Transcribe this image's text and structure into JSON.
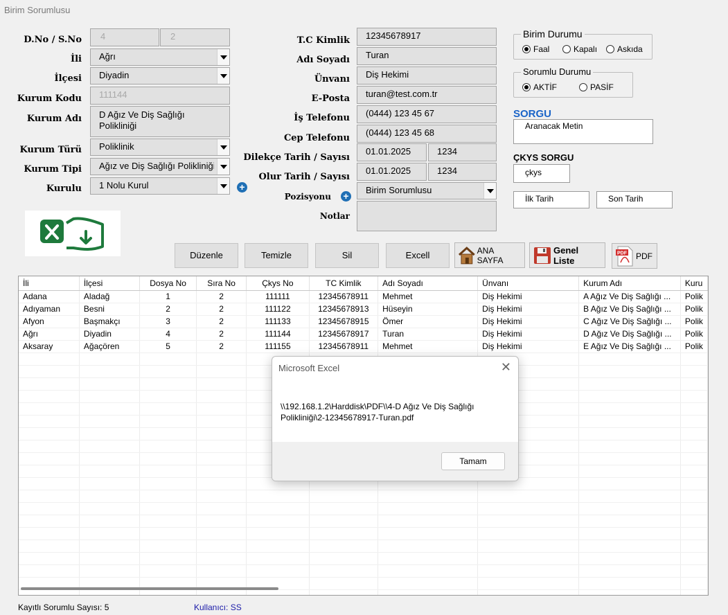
{
  "window": {
    "title": "Birim Sorumlusu"
  },
  "left": {
    "dno_label": "D.No / S.No",
    "dno_value": "4",
    "sno_value": "2",
    "ili_label": "İli",
    "ili_value": "Ağrı",
    "ilcesi_label": "İlçesi",
    "ilcesi_value": "Diyadin",
    "kurum_kodu_label": "Kurum Kodu",
    "kurum_kodu_value": "111144",
    "kurum_adi_label": "Kurum Adı",
    "kurum_adi_value": "D Ağız Ve Diş Sağlığı Polikliniği",
    "kurum_turu_label": "Kurum Türü",
    "kurum_turu_value": "Poliklinik",
    "kurum_tipi_label": "Kurum Tipi",
    "kurum_tipi_value": "Ağız ve Diş Sağlığı Polikliniği",
    "kurulu_label": "Kurulu",
    "kurulu_value": "1 Nolu Kurul"
  },
  "middle": {
    "tc_label": "T.C Kimlik",
    "tc_value": "12345678917",
    "adsoyad_label": "Adı Soyadı",
    "adsoyad_value": "Turan",
    "unvani_label": "Ünvanı",
    "unvani_value": "Diş Hekimi",
    "eposta_label": "E-Posta",
    "eposta_value": "turan@test.com.tr",
    "is_tel_label": "İş Telefonu",
    "is_tel_value": "(0444) 123 45 67",
    "cep_tel_label": "Cep Telefonu",
    "cep_tel_value": "(0444) 123 45 68",
    "dilekce_label": "Dilekçe Tarih / Sayısı",
    "dilekce_tarih": "01.01.2025",
    "dilekce_sayi": "1234",
    "olur_label": "Olur Tarih / Sayısı",
    "olur_tarih": "01.01.2025",
    "olur_sayi": "1234",
    "pozisyonu_label": "Pozisyonu",
    "pozisyonu_value": "Birim Sorumlusu",
    "notlar_label": "Notlar",
    "notlar_value": ""
  },
  "right": {
    "birim_durumu_title": "Birim Durumu",
    "birim_faal": "Faal",
    "birim_kapali": "Kapalı",
    "birim_askida": "Askıda",
    "sorumlu_durumu_title": "Sorumlu Durumu",
    "sorumlu_aktif": "AKTİF",
    "sorumlu_pasif": "PASİF",
    "sorgu_title": "SORGU",
    "sorgu_placeholder": "Aranacak Metin",
    "ckys_title": "ÇKYS SORGU",
    "ckys_placeholder": "çkys",
    "ilk_tarih": "İlk Tarih",
    "son_tarih": "Son Tarih"
  },
  "toolbar": {
    "duzenle": "Düzenle",
    "temizle": "Temizle",
    "sil": "Sil",
    "excell": "Excell",
    "ana_sayfa": "ANA SAYFA",
    "genel_liste": "Genel Liste",
    "pdf": "PDF"
  },
  "grid": {
    "columns": [
      "İli",
      "İlçesi",
      "Dosya No",
      "Sıra No",
      "Çkys No",
      "TC Kimlik",
      "Adı Soyadı",
      "Ünvanı",
      "Kurum Adı",
      "Kuru"
    ],
    "rows": [
      [
        "Adana",
        "Aladağ",
        "1",
        "2",
        "111111",
        "12345678911",
        "Mehmet",
        "Diş Hekimi",
        "A Ağız Ve Diş Sağlığı ...",
        "Polik"
      ],
      [
        "Adıyaman",
        "Besni",
        "2",
        "2",
        "111122",
        "12345678913",
        "Hüseyin",
        "Diş Hekimi",
        "B Ağız Ve Diş Sağlığı ...",
        "Polik"
      ],
      [
        "Afyon",
        "Başmakçı",
        "3",
        "2",
        "111133",
        "12345678915",
        "Ömer",
        "Diş Hekimi",
        "C Ağız Ve Diş Sağlığı ...",
        "Polik"
      ],
      [
        "Ağrı",
        "Diyadin",
        "4",
        "2",
        "111144",
        "12345678917",
        "Turan",
        "Diş Hekimi",
        "D Ağız Ve Diş Sağlığı ...",
        "Polik"
      ],
      [
        "Aksaray",
        "Ağaçören",
        "5",
        "2",
        "111155",
        "12345678911",
        "Mehmet",
        "Diş Hekimi",
        "E Ağız Ve Diş Sağlığı ...",
        "Polik"
      ]
    ]
  },
  "dialog": {
    "title": "Microsoft Excel",
    "message": "\\\\192.168.1.2\\Harddisk\\PDF\\\\4-D Ağız Ve Diş Sağlığı Polikliniği\\2-12345678917-Turan.pdf",
    "ok": "Tamam"
  },
  "status": {
    "count_text": "Kayıtlı Sorumlu Sayısı: 5",
    "user_text": "Kullanıcı: SS"
  },
  "colors": {
    "accent_blue": "#1a64c8",
    "excel_green": "#1e7a3c",
    "user_text": "#1a1aa8"
  }
}
